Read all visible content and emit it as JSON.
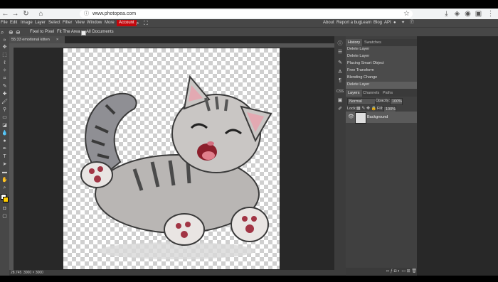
{
  "browser": {
    "url": "www.photopea.com",
    "nav_icons": [
      "back-icon",
      "forward-icon",
      "reload-icon",
      "home-icon"
    ],
    "right_icons": [
      "star-icon",
      "download-icon",
      "shield-icon",
      "profile-icon",
      "extensions-icon",
      "menu-icon"
    ]
  },
  "menu": {
    "items": [
      "File",
      "Edit",
      "Image",
      "Layer",
      "Select",
      "Filter",
      "View",
      "Window",
      "More"
    ],
    "account": "Account",
    "right_items": [
      "About",
      "Report a bug",
      "Learn",
      "Blog",
      "API"
    ]
  },
  "tool_options": {
    "pixel_button": "Fixel to Pixel",
    "fit_button": "Fit The Area",
    "all_docs_label": "All Documents"
  },
  "document": {
    "tab_title": "55:33 emotional kitten",
    "close": "×",
    "status_zoom": "28.745",
    "status_size": "3000 × 3000"
  },
  "history_panel": {
    "tabs": [
      "History",
      "Swatches"
    ],
    "items": [
      "Delete Layer",
      "Delete Layer",
      "Placing Smart Object",
      "Free Transform",
      "Blending Change",
      "Delete Layer"
    ]
  },
  "layers_panel": {
    "tabs": [
      "Layers",
      "Channels",
      "Paths"
    ],
    "blend_mode": "Normal",
    "opacity_label": "Opacity:",
    "opacity_value": "100%",
    "lock_label": "Lock:",
    "fill_label": "Fill:",
    "fill_value": "100%",
    "layers": [
      {
        "name": "Background"
      }
    ]
  },
  "colors": {
    "accent": "#c2070c",
    "foreground": "#ffffff",
    "background_swatch": "#ffcc00"
  }
}
